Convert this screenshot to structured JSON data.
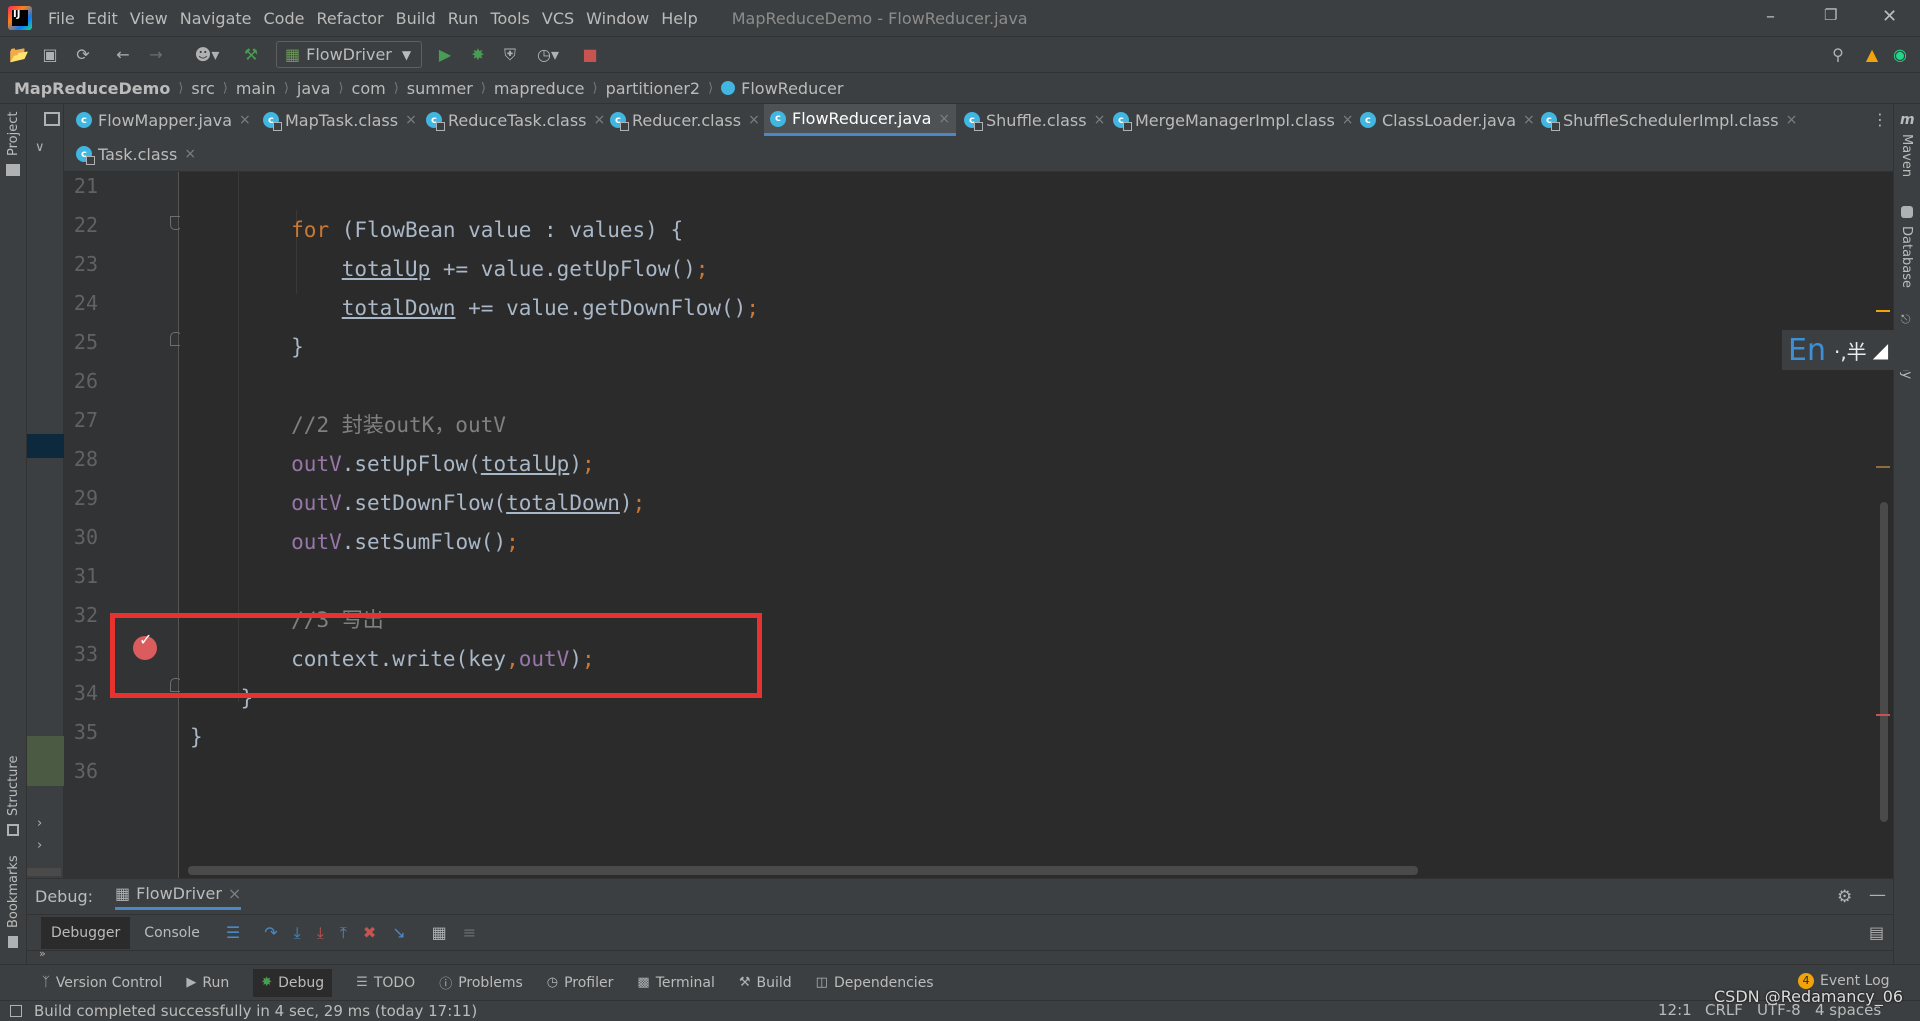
{
  "window": {
    "title": "MapReduceDemo - FlowReducer.java",
    "menu": [
      "File",
      "Edit",
      "View",
      "Navigate",
      "Code",
      "Refactor",
      "Build",
      "Run",
      "Tools",
      "VCS",
      "Window",
      "Help"
    ],
    "controls": {
      "minimize": "–",
      "restore": "❐",
      "close": "✕"
    }
  },
  "toolbar": {
    "run_config": "FlowDriver",
    "icons": [
      "open-icon",
      "save-icon",
      "sync-icon",
      "back-icon",
      "forward-icon",
      "vcs-user-icon",
      "build-hammer-icon",
      "run-icon",
      "debug-icon",
      "coverage-icon",
      "profile-icon",
      "stop-icon",
      "search-icon",
      "update-icon",
      "plugin-icon"
    ]
  },
  "breadcrumbs": [
    "MapReduceDemo",
    "src",
    "main",
    "java",
    "com",
    "summer",
    "mapreduce",
    "partitioner2",
    "FlowReducer"
  ],
  "tabs": [
    {
      "label": "FlowMapper.java",
      "kind": "java",
      "active": false
    },
    {
      "label": "MapTask.class",
      "kind": "class",
      "active": false
    },
    {
      "label": "ReduceTask.class",
      "kind": "class",
      "active": false
    },
    {
      "label": "Reducer.class",
      "kind": "class",
      "active": false
    },
    {
      "label": "FlowReducer.java",
      "kind": "java",
      "active": true
    },
    {
      "label": "Shuffle.class",
      "kind": "class",
      "active": false
    },
    {
      "label": "MergeManagerImpl.class",
      "kind": "class",
      "active": false
    },
    {
      "label": "ClassLoader.java",
      "kind": "java",
      "active": false
    },
    {
      "label": "ShuffleSchedulerImpl.class",
      "kind": "class",
      "active": false
    },
    {
      "label": "Task.class",
      "kind": "class",
      "active": false
    }
  ],
  "side_labels": {
    "project": "Project",
    "structure": "Structure",
    "bookmarks": "Bookmarks",
    "maven": "Maven",
    "database": "Database",
    "hierarchy": "chy"
  },
  "editor": {
    "inspections": {
      "warnings": "2",
      "weak_warnings": "1"
    },
    "line_numbers": [
      "21",
      "22",
      "23",
      "24",
      "25",
      "26",
      "27",
      "28",
      "29",
      "30",
      "31",
      "32",
      "33",
      "34",
      "35",
      "36"
    ],
    "lines": [
      {
        "segments": []
      },
      {
        "segments": [
          {
            "t": "        "
          },
          {
            "t": "for",
            "c": "kw"
          },
          {
            "t": " (FlowBean value : values) {"
          }
        ]
      },
      {
        "segments": [
          {
            "t": "            "
          },
          {
            "t": "totalUp",
            "c": "und"
          },
          {
            "t": " += value.getUpFlow()"
          },
          {
            "t": ";",
            "c": "kw"
          }
        ]
      },
      {
        "segments": [
          {
            "t": "            "
          },
          {
            "t": "totalDown",
            "c": "und"
          },
          {
            "t": " += value.getDownFlow()"
          },
          {
            "t": ";",
            "c": "kw"
          }
        ]
      },
      {
        "segments": [
          {
            "t": "        }"
          }
        ]
      },
      {
        "segments": []
      },
      {
        "segments": [
          {
            "t": "        "
          },
          {
            "t": "//2 封装outK，outV",
            "c": "cmt"
          }
        ]
      },
      {
        "segments": [
          {
            "t": "        "
          },
          {
            "t": "outV",
            "c": "field"
          },
          {
            "t": ".setUpFlow("
          },
          {
            "t": "totalUp",
            "c": "und"
          },
          {
            "t": ")"
          },
          {
            "t": ";",
            "c": "kw"
          }
        ]
      },
      {
        "segments": [
          {
            "t": "        "
          },
          {
            "t": "outV",
            "c": "field"
          },
          {
            "t": ".setDownFlow("
          },
          {
            "t": "totalDown",
            "c": "und"
          },
          {
            "t": ")"
          },
          {
            "t": ";",
            "c": "kw"
          }
        ]
      },
      {
        "segments": [
          {
            "t": "        "
          },
          {
            "t": "outV",
            "c": "field"
          },
          {
            "t": ".setSumFlow()"
          },
          {
            "t": ";",
            "c": "kw"
          }
        ]
      },
      {
        "segments": []
      },
      {
        "segments": [
          {
            "t": "        "
          },
          {
            "t": "//3 写出",
            "c": "cmt"
          }
        ]
      },
      {
        "segments": [
          {
            "t": "        context.write(key"
          },
          {
            "t": ",",
            "c": "kw"
          },
          {
            "t": "outV",
            "c": "field"
          },
          {
            "t": ")"
          },
          {
            "t": ";",
            "c": "kw"
          }
        ]
      },
      {
        "segments": [
          {
            "t": "    }"
          }
        ]
      },
      {
        "segments": [
          {
            "t": "}"
          }
        ]
      },
      {
        "segments": []
      }
    ]
  },
  "ime": {
    "lang": "En",
    "rest": "·,半"
  },
  "debug": {
    "label": "Debug:",
    "session": "FlowDriver",
    "tabs": [
      "Debugger",
      "Console"
    ]
  },
  "bottom_tools": [
    {
      "label": "Version Control",
      "icon": "branch-icon",
      "active": false
    },
    {
      "label": "Run",
      "icon": "run-icon",
      "active": false
    },
    {
      "label": "Debug",
      "icon": "debug-icon",
      "active": true
    },
    {
      "label": "TODO",
      "icon": "todo-icon",
      "active": false
    },
    {
      "label": "Problems",
      "icon": "problems-icon",
      "active": false
    },
    {
      "label": "Profiler",
      "icon": "profiler-icon",
      "active": false
    },
    {
      "label": "Terminal",
      "icon": "terminal-icon",
      "active": false
    },
    {
      "label": "Build",
      "icon": "build-icon",
      "active": false
    },
    {
      "label": "Dependencies",
      "icon": "dependencies-icon",
      "active": false
    }
  ],
  "event_log": {
    "label": "Event Log",
    "count": "4"
  },
  "status": {
    "message": "Build completed successfully in 4 sec, 29 ms (today 17:11)",
    "position": "12:1",
    "line_sep": "CRLF",
    "encoding": "UTF-8",
    "indent": "4 spaces",
    "watermark": "CSDN @Redamancy_06"
  },
  "colors": {
    "accent": "#4a88c7",
    "breakpoint": "#db5c5c",
    "annotation_box": "#e8322f"
  }
}
